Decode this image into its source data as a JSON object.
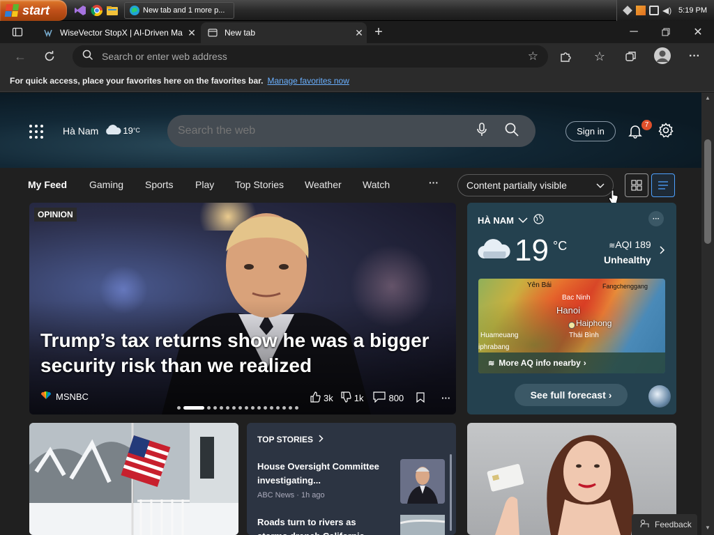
{
  "taskbar": {
    "start_label": "start",
    "task_edge_label": "New tab and 1 more p...",
    "clock": "5:19 PM"
  },
  "browser": {
    "tabs": [
      {
        "label": "WiseVector StopX | AI-Driven Ma"
      },
      {
        "label": "New tab"
      }
    ],
    "address_placeholder": "Search or enter web address",
    "favbar_text": "For quick access, place your favorites here on the favorites bar.",
    "favbar_link": "Manage favorites now"
  },
  "header": {
    "location": "Hà Nam",
    "temp": "19",
    "temp_unit": "°C",
    "search_placeholder": "Search the web",
    "sign_in": "Sign in",
    "notification_count": "7"
  },
  "feed_nav": {
    "tabs": [
      "My Feed",
      "Gaming",
      "Sports",
      "Play",
      "Top Stories",
      "Weather",
      "Watch"
    ],
    "more": "···",
    "content_dropdown": "Content partially visible"
  },
  "hero": {
    "badge": "OPINION",
    "headline": "Trump’s tax returns show he was a bigger security risk than we realized",
    "source": "MSNBC",
    "likes": "3k",
    "dislikes": "1k",
    "comments": "800"
  },
  "weather": {
    "location": "HÀ NAM",
    "temp": "19",
    "unit": "°C",
    "aqi": "AQI 189",
    "aqi_status": "Unhealthy",
    "map_labels": {
      "yen_bai": "Yên Bái",
      "fangchenggang": "Fangchenggang",
      "bac_ninh": "Bac Ninh",
      "hanoi": "Hanoi",
      "haiphong": "Haiphong",
      "thai_binh": "Thái Bình",
      "huameuang": "Huameuang",
      "phrabang": "iphrabang"
    },
    "more_aq": "More AQ info nearby",
    "forecast_btn": "See full forecast"
  },
  "top_stories": {
    "header": "TOP STORIES",
    "items": [
      {
        "title": "House Oversight Committee investigating...",
        "meta": "ABC News · 1h ago"
      },
      {
        "title": "Roads turn to rivers as storms drench California"
      }
    ]
  },
  "feedback_label": "Feedback",
  "colors": {
    "accent_blue": "#4ea1ff",
    "weather_card": "#24414f",
    "notification_badge": "#e0502b"
  }
}
